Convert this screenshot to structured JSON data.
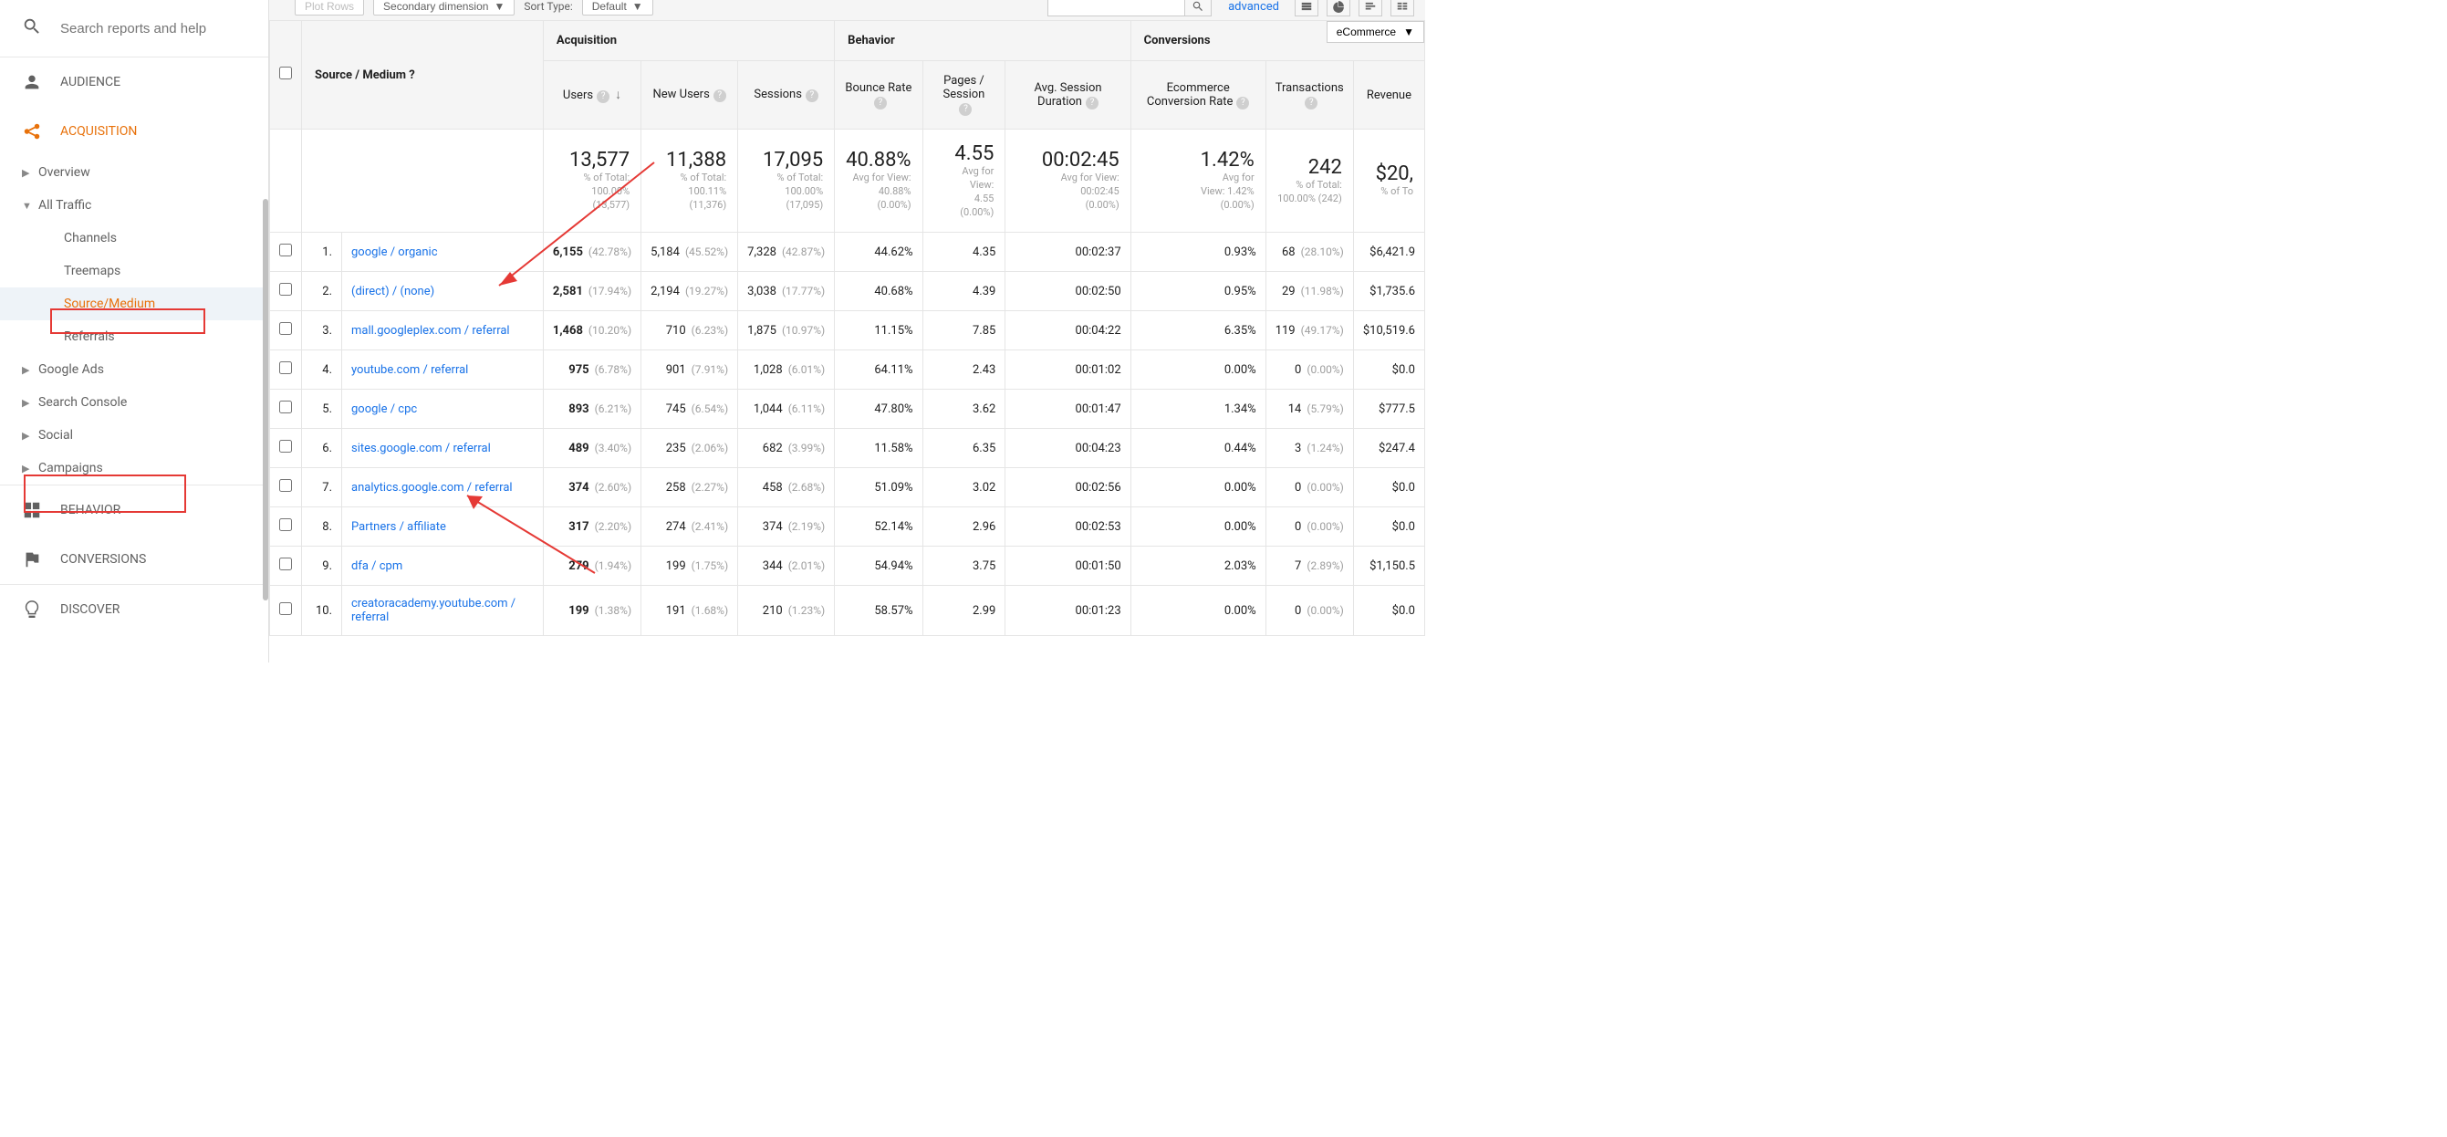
{
  "sidebar": {
    "search_placeholder": "Search reports and help",
    "sections": [
      {
        "label": "AUDIENCE",
        "icon": "person"
      },
      {
        "label": "ACQUISITION",
        "icon": "share",
        "orange": true
      },
      {
        "label": "BEHAVIOR",
        "icon": "grid"
      },
      {
        "label": "CONVERSIONS",
        "icon": "flag"
      },
      {
        "label": "DISCOVER",
        "icon": "bulb"
      }
    ],
    "acq_items": [
      {
        "label": "Overview"
      },
      {
        "label": "All Traffic",
        "expanded": true
      },
      {
        "label": "Channels",
        "indent": true
      },
      {
        "label": "Treemaps",
        "indent": true
      },
      {
        "label": "Source/Medium",
        "indent": true,
        "active": true
      },
      {
        "label": "Referrals",
        "indent": true
      },
      {
        "label": "Google Ads"
      },
      {
        "label": "Search Console"
      },
      {
        "label": "Social"
      },
      {
        "label": "Campaigns"
      }
    ]
  },
  "toolbar": {
    "plot_rows": "Plot Rows",
    "secondary_dim": "Secondary dimension",
    "sort_type": "Sort Type:",
    "sort_default": "Default",
    "advanced": "advanced"
  },
  "table": {
    "dim_header": "Source / Medium",
    "groups": {
      "acquisition": "Acquisition",
      "behavior": "Behavior",
      "conversions": "Conversions"
    },
    "conv_select": "eCommerce",
    "columns": {
      "users": "Users",
      "new_users": "New Users",
      "sessions": "Sessions",
      "bounce": "Bounce Rate",
      "pages": "Pages / Session",
      "duration": "Avg. Session Duration",
      "ecr": "Ecommerce Conversion Rate",
      "transactions": "Transactions",
      "revenue": "Revenue"
    },
    "totals": {
      "users": {
        "big": "13,577",
        "sub1": "% of Total:",
        "sub2": "100.00%",
        "sub3": "(13,577)"
      },
      "new_users": {
        "big": "11,388",
        "sub1": "% of Total:",
        "sub2": "100.11%",
        "sub3": "(11,376)"
      },
      "sessions": {
        "big": "17,095",
        "sub1": "% of Total:",
        "sub2": "100.00%",
        "sub3": "(17,095)"
      },
      "bounce": {
        "big": "40.88%",
        "sub1": "Avg for View:",
        "sub2": "40.88%",
        "sub3": "(0.00%)"
      },
      "pages": {
        "big": "4.55",
        "sub1": "Avg for",
        "sub2": "View:",
        "sub3": "4.55",
        "sub4": "(0.00%)"
      },
      "duration": {
        "big": "00:02:45",
        "sub1": "Avg for View:",
        "sub2": "00:02:45",
        "sub3": "(0.00%)"
      },
      "ecr": {
        "big": "1.42%",
        "sub1": "Avg for",
        "sub2": "View: 1.42%",
        "sub3": "(0.00%)"
      },
      "transactions": {
        "big": "242",
        "sub1": "% of Total:",
        "sub2": "100.00% (242)"
      },
      "revenue": {
        "big": "$20,",
        "sub1": "% of To"
      }
    },
    "rows": [
      {
        "idx": "1.",
        "dim": "google / organic",
        "users": "6,155",
        "users_p": "(42.78%)",
        "nu": "5,184",
        "nu_p": "(45.52%)",
        "sess": "7,328",
        "sess_p": "(42.87%)",
        "bounce": "44.62%",
        "pages": "4.35",
        "dur": "00:02:37",
        "ecr": "0.93%",
        "tx": "68",
        "tx_p": "(28.10%)",
        "rev": "$6,421.9"
      },
      {
        "idx": "2.",
        "dim": "(direct) / (none)",
        "users": "2,581",
        "users_p": "(17.94%)",
        "nu": "2,194",
        "nu_p": "(19.27%)",
        "sess": "3,038",
        "sess_p": "(17.77%)",
        "bounce": "40.68%",
        "pages": "4.39",
        "dur": "00:02:50",
        "ecr": "0.95%",
        "tx": "29",
        "tx_p": "(11.98%)",
        "rev": "$1,735.6"
      },
      {
        "idx": "3.",
        "dim": "mall.googleplex.com / referral",
        "users": "1,468",
        "users_p": "(10.20%)",
        "nu": "710",
        "nu_p": "(6.23%)",
        "sess": "1,875",
        "sess_p": "(10.97%)",
        "bounce": "11.15%",
        "pages": "7.85",
        "dur": "00:04:22",
        "ecr": "6.35%",
        "tx": "119",
        "tx_p": "(49.17%)",
        "rev": "$10,519.6"
      },
      {
        "idx": "4.",
        "dim": "youtube.com / referral",
        "users": "975",
        "users_p": "(6.78%)",
        "nu": "901",
        "nu_p": "(7.91%)",
        "sess": "1,028",
        "sess_p": "(6.01%)",
        "bounce": "64.11%",
        "pages": "2.43",
        "dur": "00:01:02",
        "ecr": "0.00%",
        "tx": "0",
        "tx_p": "(0.00%)",
        "rev": "$0.0"
      },
      {
        "idx": "5.",
        "dim": "google / cpc",
        "users": "893",
        "users_p": "(6.21%)",
        "nu": "745",
        "nu_p": "(6.54%)",
        "sess": "1,044",
        "sess_p": "(6.11%)",
        "bounce": "47.80%",
        "pages": "3.62",
        "dur": "00:01:47",
        "ecr": "1.34%",
        "tx": "14",
        "tx_p": "(5.79%)",
        "rev": "$777.5"
      },
      {
        "idx": "6.",
        "dim": "sites.google.com / referral",
        "users": "489",
        "users_p": "(3.40%)",
        "nu": "235",
        "nu_p": "(2.06%)",
        "sess": "682",
        "sess_p": "(3.99%)",
        "bounce": "11.58%",
        "pages": "6.35",
        "dur": "00:04:23",
        "ecr": "0.44%",
        "tx": "3",
        "tx_p": "(1.24%)",
        "rev": "$247.4"
      },
      {
        "idx": "7.",
        "dim": "analytics.google.com / referral",
        "users": "374",
        "users_p": "(2.60%)",
        "nu": "258",
        "nu_p": "(2.27%)",
        "sess": "458",
        "sess_p": "(2.68%)",
        "bounce": "51.09%",
        "pages": "3.02",
        "dur": "00:02:56",
        "ecr": "0.00%",
        "tx": "0",
        "tx_p": "(0.00%)",
        "rev": "$0.0"
      },
      {
        "idx": "8.",
        "dim": "Partners / affiliate",
        "users": "317",
        "users_p": "(2.20%)",
        "nu": "274",
        "nu_p": "(2.41%)",
        "sess": "374",
        "sess_p": "(2.19%)",
        "bounce": "52.14%",
        "pages": "2.96",
        "dur": "00:02:53",
        "ecr": "0.00%",
        "tx": "0",
        "tx_p": "(0.00%)",
        "rev": "$0.0"
      },
      {
        "idx": "9.",
        "dim": "dfa / cpm",
        "users": "279",
        "users_p": "(1.94%)",
        "nu": "199",
        "nu_p": "(1.75%)",
        "sess": "344",
        "sess_p": "(2.01%)",
        "bounce": "54.94%",
        "pages": "3.75",
        "dur": "00:01:50",
        "ecr": "2.03%",
        "tx": "7",
        "tx_p": "(2.89%)",
        "rev": "$1,150.5"
      },
      {
        "idx": "10.",
        "dim": "creatoracademy.youtube.com / referral",
        "users": "199",
        "users_p": "(1.38%)",
        "nu": "191",
        "nu_p": "(1.68%)",
        "sess": "210",
        "sess_p": "(1.23%)",
        "bounce": "58.57%",
        "pages": "2.99",
        "dur": "00:01:23",
        "ecr": "0.00%",
        "tx": "0",
        "tx_p": "(0.00%)",
        "rev": "$0.0"
      }
    ]
  }
}
